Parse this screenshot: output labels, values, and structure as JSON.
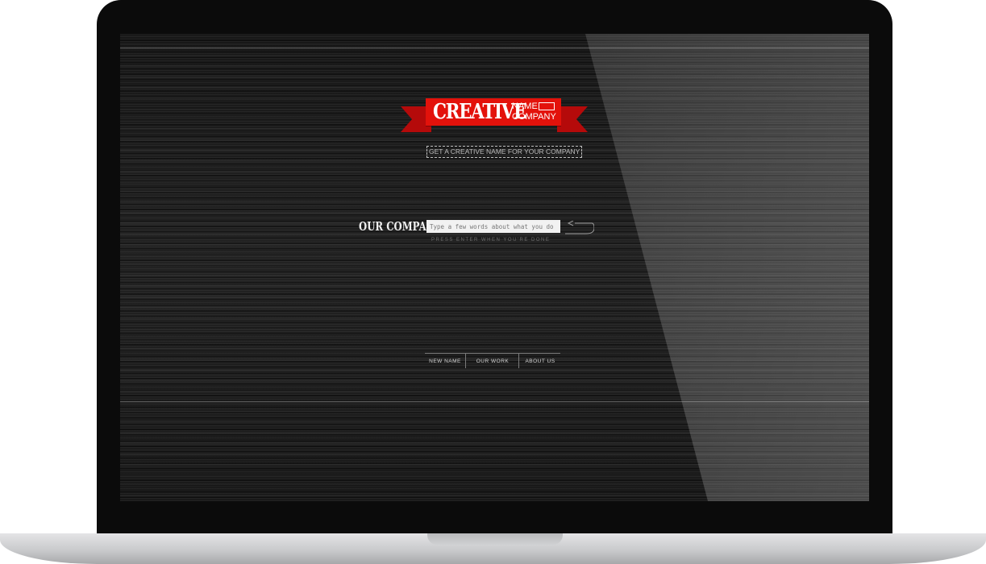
{
  "logo": {
    "title": "CREATIVE",
    "word1": "NAME",
    "word2": "COMPANY",
    "color": "#e3120b"
  },
  "tagline": "GET A CREATIVE NAME FOR YOUR COMPANY",
  "form": {
    "label": "OUR COMPANY:",
    "placeholder": "Type a few words about what you do",
    "value": "",
    "hint": "PRESS ENTER WHEN YOU'RE DONE",
    "enter_icon": "return-arrow-icon"
  },
  "nav": {
    "items": [
      {
        "label": "NEW NAME"
      },
      {
        "label": "OUR WORK"
      },
      {
        "label": "ABOUT US"
      }
    ]
  }
}
